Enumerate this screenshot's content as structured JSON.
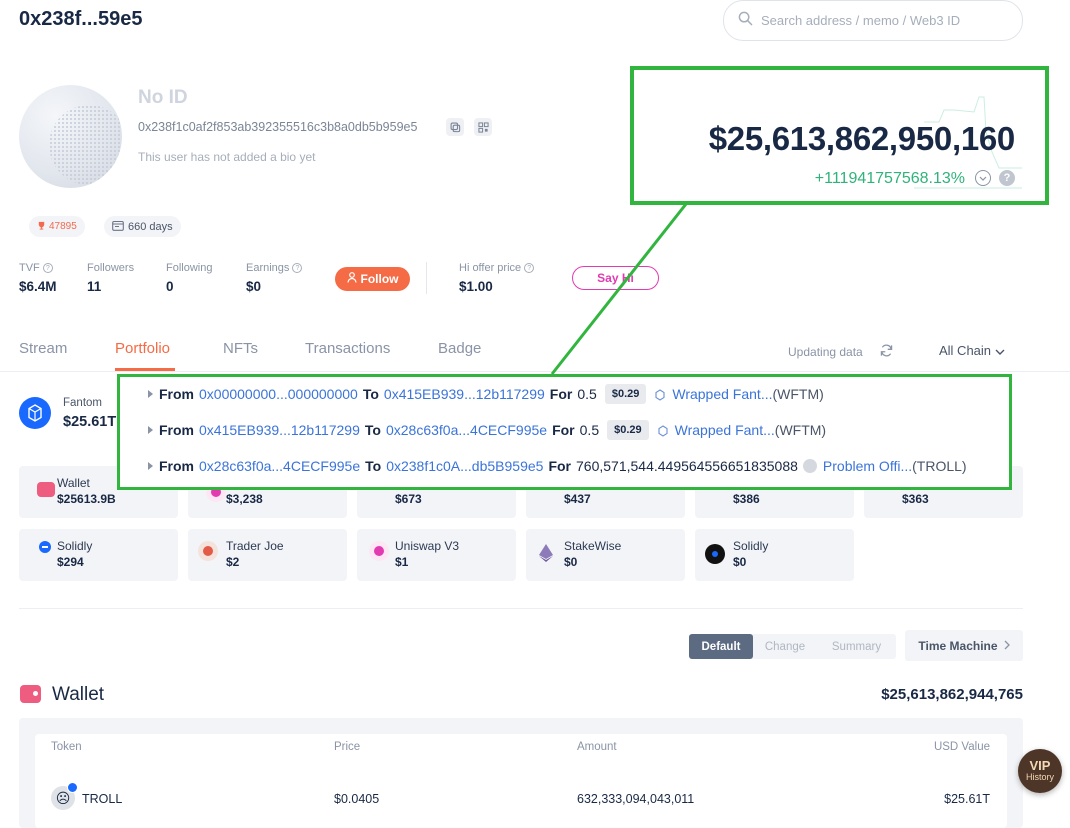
{
  "header": {
    "address_short": "0x238f...59e5",
    "search_placeholder": "Search address / memo / Web3 ID"
  },
  "profile": {
    "name": "No ID",
    "full_address": "0x238f1c0af2f853ab392355516c3b8a0db5b959e5",
    "bio": "This user has not added a bio yet",
    "rank": "47895",
    "days": "660 days"
  },
  "stats": {
    "tvf_label": "TVF",
    "tvf_value": "$6.4M",
    "followers_label": "Followers",
    "followers_value": "11",
    "following_label": "Following",
    "following_value": "0",
    "earnings_label": "Earnings",
    "earnings_value": "$0",
    "follow_label": "Follow",
    "hi_offer_label": "Hi offer price",
    "hi_offer_value": "$1.00",
    "sayhi_label": "Say Hi"
  },
  "networth": {
    "value": "$25,613,862,950,160",
    "change": "+111941757568.13%",
    "help": "?"
  },
  "tabs": {
    "items": [
      "Stream",
      "Portfolio",
      "NFTs",
      "Transactions",
      "Badge"
    ],
    "active": "Portfolio",
    "updating": "Updating data",
    "chain_filter": "All Chain"
  },
  "chain_summary": {
    "name": "Fantom",
    "value": "$25.61T"
  },
  "protocol_cards": {
    "row1": [
      {
        "name": "Wallet",
        "value": "$25613.9B"
      },
      {
        "name": "",
        "value": "$3,238"
      },
      {
        "name": "",
        "value": "$673"
      },
      {
        "name": "",
        "value": "$437"
      },
      {
        "name": "",
        "value": "$386"
      },
      {
        "name": "",
        "value": "$363"
      }
    ],
    "row2": [
      {
        "name": "Solidly",
        "value": "$294"
      },
      {
        "name": "Trader Joe",
        "value": "$2"
      },
      {
        "name": "Uniswap V3",
        "value": "$1"
      },
      {
        "name": "StakeWise",
        "value": "$0"
      },
      {
        "name": "Solidly",
        "value": "$0"
      }
    ]
  },
  "transfers": {
    "from_kw": "From",
    "to_kw": "To",
    "for_kw": "For",
    "rows": [
      {
        "from": "0x00000000...000000000",
        "to": "0x415EB939...12b117299",
        "amount": "0.5",
        "price": "$0.29",
        "token_name": "Wrapped Fant...",
        "token_symbol": "(WFTM)"
      },
      {
        "from": "0x415EB939...12b117299",
        "to": "0x28c63f0a...4CECF995e",
        "amount": "0.5",
        "price": "$0.29",
        "token_name": "Wrapped Fant...",
        "token_symbol": "(WFTM)"
      },
      {
        "from": "0x28c63f0a...4CECF995e",
        "to": "0x238f1c0A...db5B959e5",
        "amount": "760,571,544.449564556651835088",
        "price": "",
        "token_name": "Problem Offi...",
        "token_symbol": "(TROLL)"
      }
    ]
  },
  "view_toggle": {
    "options": [
      "Default",
      "Change",
      "Summary"
    ],
    "active": "Default",
    "time_machine": "Time Machine"
  },
  "wallet": {
    "title": "Wallet",
    "total": "$25,613,862,944,765",
    "columns": [
      "Token",
      "Price",
      "Amount",
      "USD Value"
    ],
    "rows": [
      {
        "token": "TROLL",
        "price": "$0.0405",
        "amount": "632,333,094,043,011",
        "usd_value": "$25.61T"
      }
    ]
  },
  "vip": {
    "title": "VIP",
    "subtitle": "History"
  },
  "colors": {
    "accent": "#f46b45",
    "highlight_green": "#31b53e",
    "positive": "#2fb37a",
    "link": "#3b74d9",
    "sayhi": "#e23bb1"
  }
}
